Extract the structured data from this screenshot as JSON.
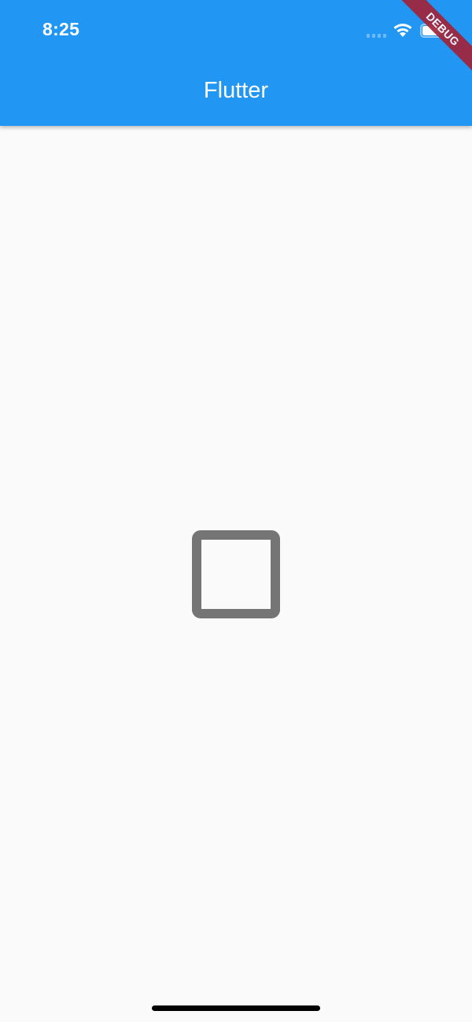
{
  "status_bar": {
    "time": "8:25"
  },
  "app_bar": {
    "title": "Flutter",
    "color": "#2196f3"
  },
  "debug_banner": {
    "label": "DEBUG"
  },
  "content": {
    "icon": "check-box-outline-blank-icon"
  },
  "colors": {
    "background": "#fafafa",
    "icon": "#757575"
  }
}
